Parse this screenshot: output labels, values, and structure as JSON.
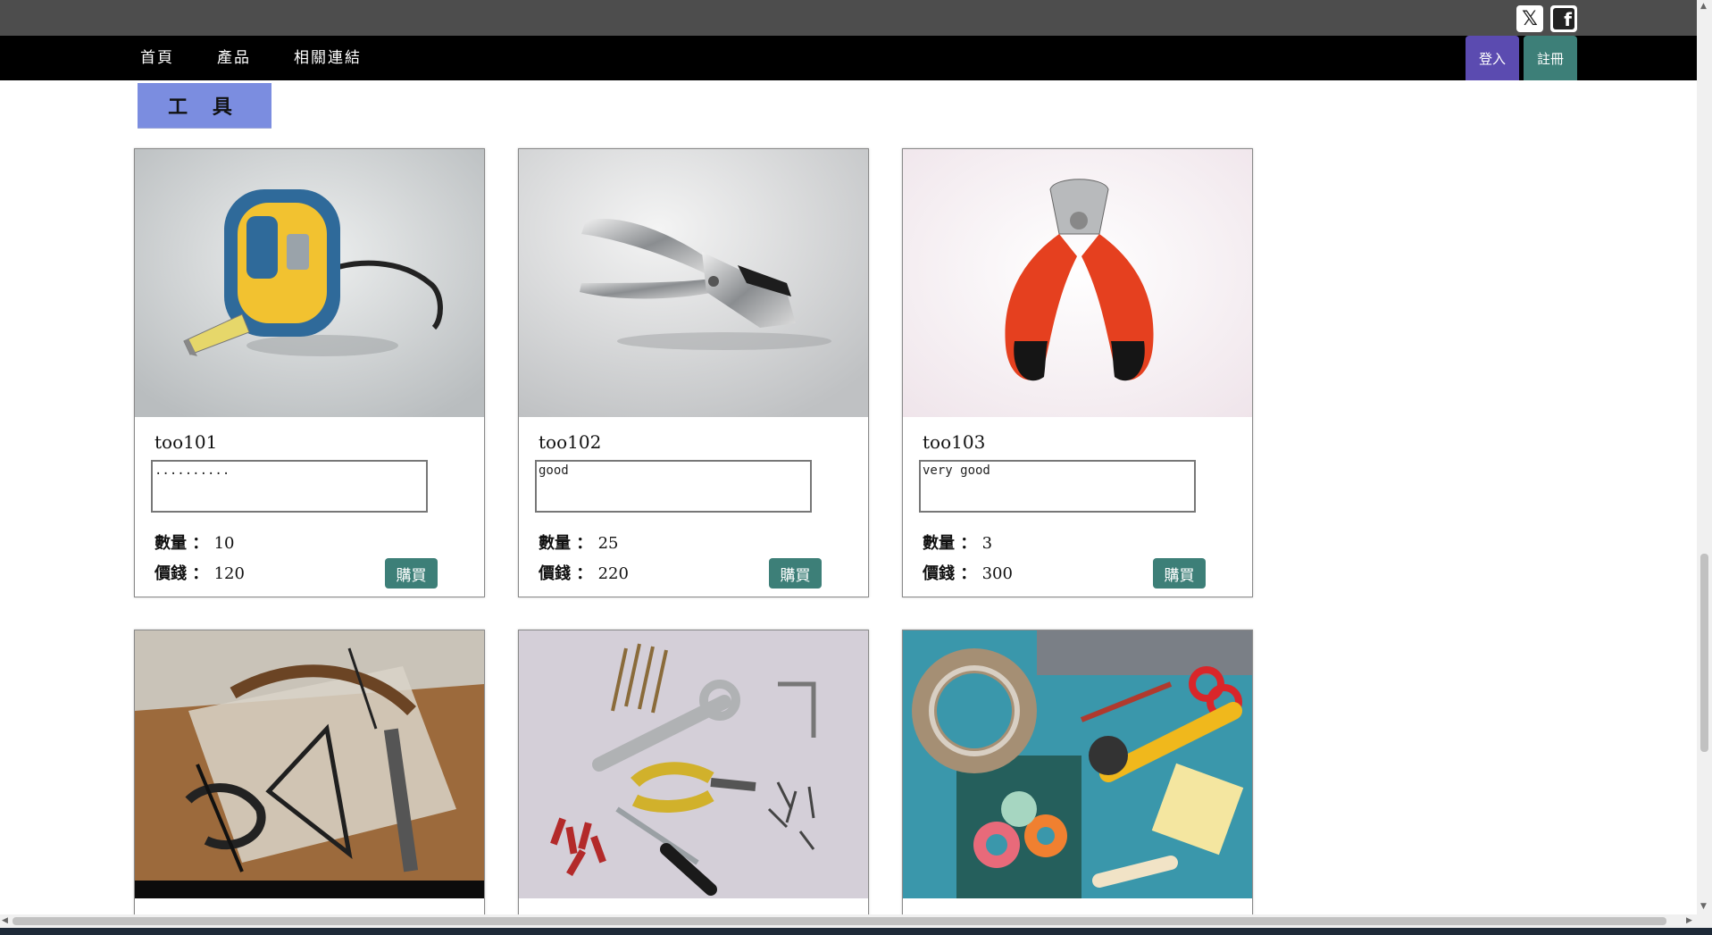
{
  "social": {
    "x_glyph": "𝕏",
    "fb_glyph": "f"
  },
  "nav": {
    "home": "首頁",
    "products": "產品",
    "links": "相關連結",
    "login": "登入",
    "register": "註冊"
  },
  "category": "工 具",
  "products": [
    {
      "name": "too101",
      "desc": "..........",
      "qty_label": "數量 ：",
      "qty": "10",
      "price_label": "價錢 ：",
      "price": "120",
      "buy": "購買"
    },
    {
      "name": "too102",
      "desc": "good",
      "qty_label": "數量 ：",
      "qty": "25",
      "price_label": "價錢 ：",
      "price": "220",
      "buy": "購買"
    },
    {
      "name": "too103",
      "desc": "very good",
      "qty_label": "數量 ：",
      "qty": "3",
      "price_label": "價錢 ：",
      "price": "300",
      "buy": "購買"
    }
  ],
  "colors": {
    "login_bg": "#5b4bb0",
    "register_bg": "#3d7f78",
    "category_bg": "#7b8de0",
    "buy_bg": "#3d7f78"
  }
}
